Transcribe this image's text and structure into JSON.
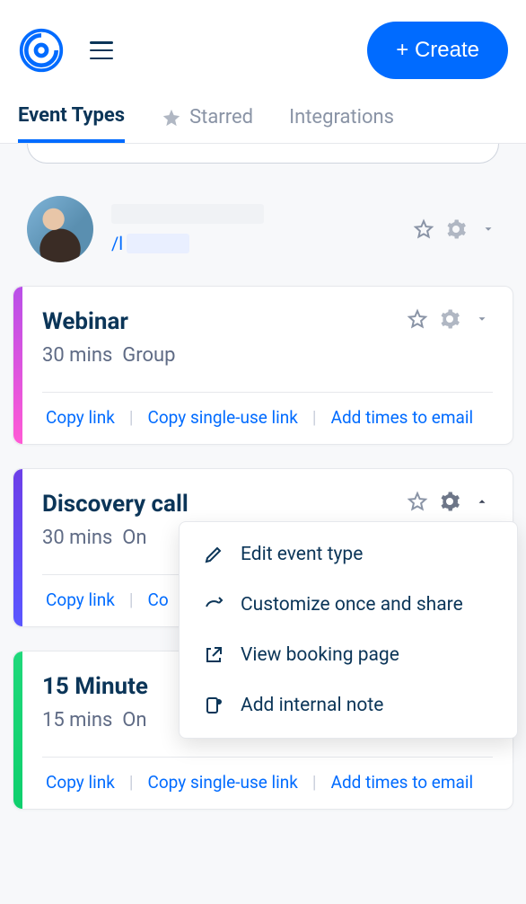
{
  "header": {
    "create_label": "+ Create"
  },
  "tabs": {
    "event_types": "Event Types",
    "starred": "Starred",
    "integrations": "Integrations"
  },
  "user": {
    "link_prefix": "/l"
  },
  "cards": [
    {
      "title": "Webinar",
      "duration": "30 mins",
      "kind": "Group",
      "stripe": "linear-gradient(180deg,#b84fe8,#ff5ad5)",
      "actions": {
        "copy": "Copy link",
        "single": "Copy single-use link",
        "times": "Add times to email"
      }
    },
    {
      "title": "Discovery call",
      "duration": "30 mins",
      "kind": "On",
      "stripe": "linear-gradient(180deg,#6d3fe8,#5a56ff)",
      "actions": {
        "copy": "Copy link",
        "single": "Co",
        "times": ""
      }
    },
    {
      "title": "15 Minute",
      "duration": "15 mins",
      "kind": "On",
      "stripe": "linear-gradient(180deg,#1fd87a,#0fcf6d)",
      "actions": {
        "copy": "Copy link",
        "single": "Copy single-use link",
        "times": "Add times to email"
      }
    }
  ],
  "menu": {
    "edit": "Edit event type",
    "customize": "Customize once and share",
    "view": "View booking page",
    "note": "Add internal note"
  }
}
